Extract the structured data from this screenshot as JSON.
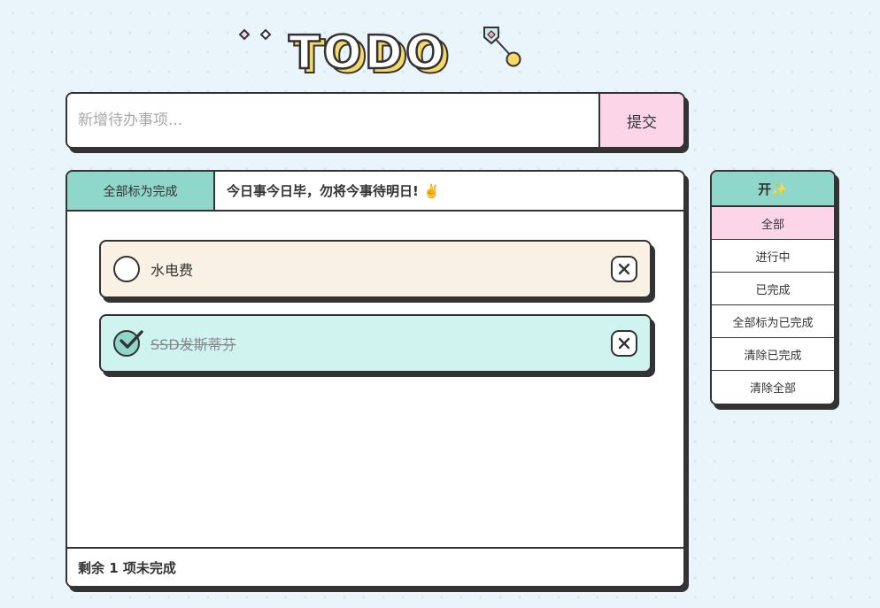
{
  "logo": {
    "text": "TODO"
  },
  "input": {
    "placeholder": "新增待办事项...",
    "value": ""
  },
  "submit": {
    "label": "提交"
  },
  "header": {
    "mark_all_label": "全部标为完成",
    "motto": "今日事今日毕，勿将今事待明日! ✌️"
  },
  "todos": [
    {
      "text": "水电费",
      "done": false
    },
    {
      "text": "SSD发斯蒂芬",
      "done": true
    }
  ],
  "footer": {
    "status": "剩余 1 项未完成"
  },
  "sidebar": {
    "title": "开✨",
    "items": [
      {
        "label": "全部",
        "active": true
      },
      {
        "label": "进行中",
        "active": false
      },
      {
        "label": "已完成",
        "active": false
      },
      {
        "label": "全部标为已完成",
        "active": false
      },
      {
        "label": "清除已完成",
        "active": false
      },
      {
        "label": "清除全部",
        "active": false
      }
    ]
  },
  "colors": {
    "teal": "#8fd6cb",
    "pink": "#fcd6e8",
    "cream": "#f8f1e4",
    "mint": "#cff3ee",
    "yellow": "#f7d766",
    "outline": "#333333"
  },
  "icons": {
    "delete": "close-icon",
    "check": "check-icon",
    "logo_decor_left": "diamond-icon",
    "logo_decor_right": "pin-icon"
  }
}
